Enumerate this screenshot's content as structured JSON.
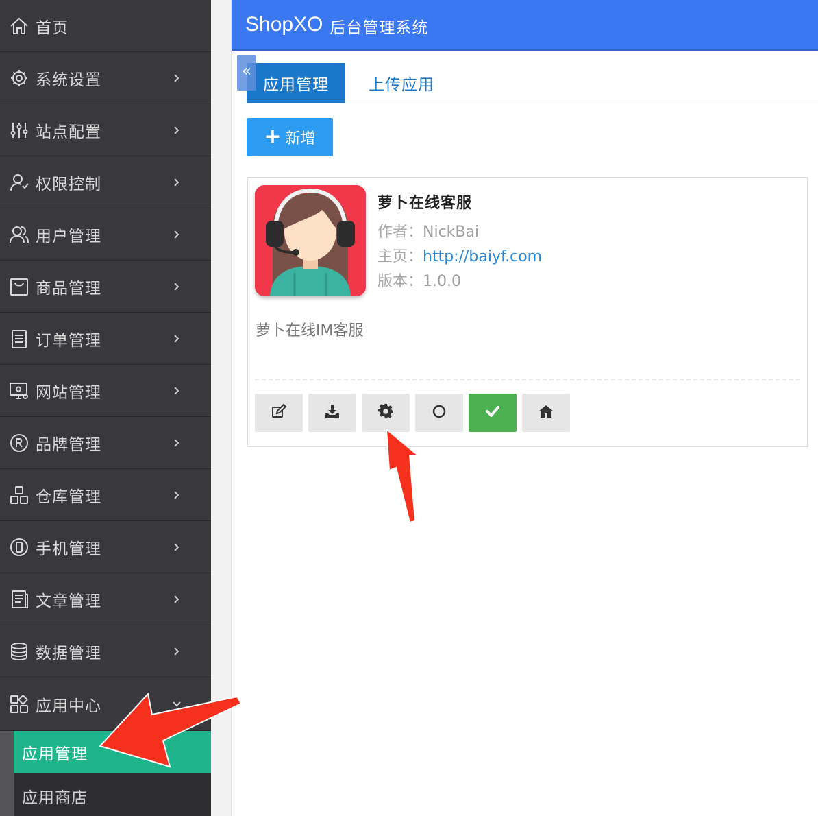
{
  "app": {
    "brand": "ShopXO",
    "brand_subtitle": "后台管理系统"
  },
  "sidebar": {
    "items": [
      {
        "label": "首页",
        "icon": "home-icon",
        "has_arrow": false
      },
      {
        "label": "系统设置",
        "icon": "gear-icon",
        "has_arrow": true
      },
      {
        "label": "站点配置",
        "icon": "sliders-icon",
        "has_arrow": true
      },
      {
        "label": "权限控制",
        "icon": "user-shield-icon",
        "has_arrow": true
      },
      {
        "label": "用户管理",
        "icon": "users-icon",
        "has_arrow": true
      },
      {
        "label": "商品管理",
        "icon": "bag-icon",
        "has_arrow": true
      },
      {
        "label": "订单管理",
        "icon": "order-list-icon",
        "has_arrow": true
      },
      {
        "label": "网站管理",
        "icon": "monitor-gear-icon",
        "has_arrow": true
      },
      {
        "label": "品牌管理",
        "icon": "registered-icon",
        "has_arrow": true
      },
      {
        "label": "仓库管理",
        "icon": "boxes-icon",
        "has_arrow": true
      },
      {
        "label": "手机管理",
        "icon": "mobile-icon",
        "has_arrow": true
      },
      {
        "label": "文章管理",
        "icon": "article-icon",
        "has_arrow": true
      },
      {
        "label": "数据管理",
        "icon": "database-icon",
        "has_arrow": true
      },
      {
        "label": "应用中心",
        "icon": "apps-grid-icon",
        "has_arrow": true,
        "expanded": true
      }
    ],
    "sub_items": [
      {
        "label": "应用管理",
        "active": true
      },
      {
        "label": "应用商店",
        "active": false
      }
    ]
  },
  "main": {
    "collapse_glyph": "«",
    "tabs": [
      {
        "label": "应用管理",
        "active": true
      },
      {
        "label": "上传应用",
        "active": false
      }
    ],
    "add_button": {
      "icon": "+",
      "label": "新增"
    },
    "plugin": {
      "name": "萝卜在线客服",
      "author_label": "作者：",
      "author": "NickBai",
      "homepage_label": "主页：",
      "homepage": "http://baiyf.com",
      "version_label": "版本：",
      "version": "1.0.0",
      "description": "萝卜在线IM客服",
      "icon": "customer-service-avatar-icon",
      "actions": [
        {
          "name": "edit-button",
          "icon": "edit-icon"
        },
        {
          "name": "download-button",
          "icon": "download-icon"
        },
        {
          "name": "settings-button",
          "icon": "gear-icon"
        },
        {
          "name": "status-toggle-button",
          "icon": "circle-icon"
        },
        {
          "name": "enabled-button",
          "icon": "check-icon",
          "color": "#4caf50"
        },
        {
          "name": "home-button",
          "icon": "home-icon"
        }
      ]
    }
  },
  "colors": {
    "header": "#3a78f2",
    "sidebar": "#39393d",
    "active_sub": "#1fb58c",
    "tab_active": "#1b77c9",
    "add_button": "#2d9cf0",
    "success": "#4caf50",
    "arrow": "#f5311d"
  }
}
